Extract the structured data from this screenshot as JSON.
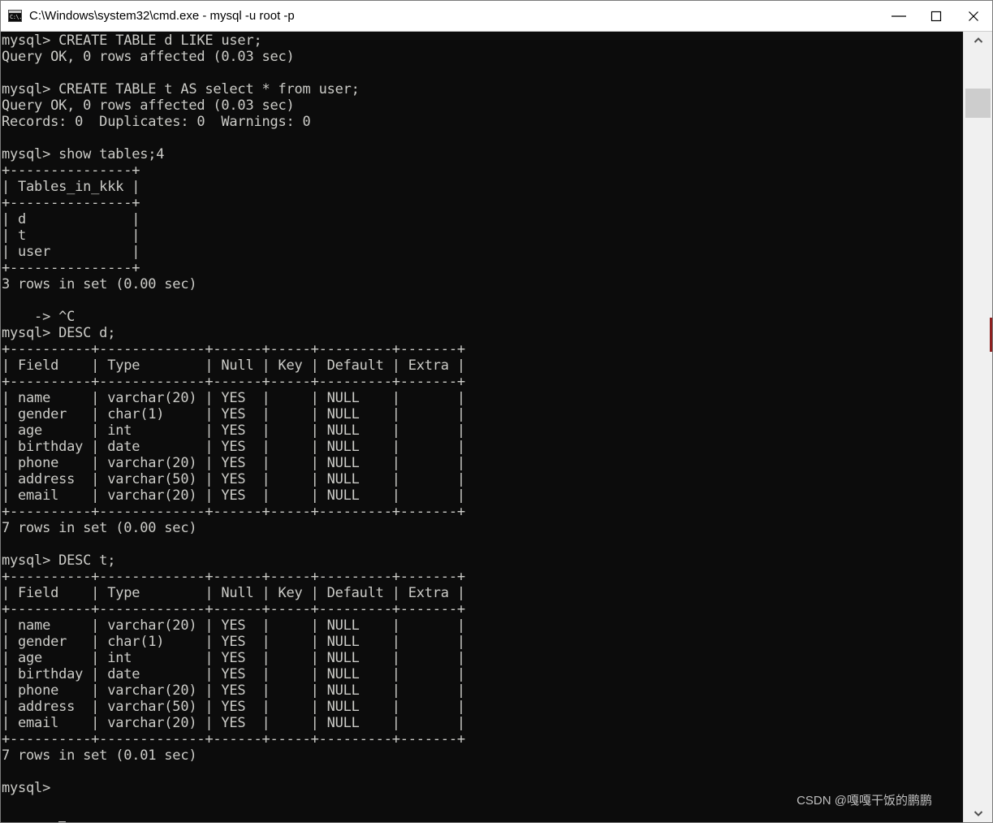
{
  "window": {
    "title": "C:\\Windows\\system32\\cmd.exe - mysql  -u root -p",
    "icon_name": "cmd-console-icon",
    "icon_text": "C:\\.",
    "bg_color": "#0c0c0c",
    "fg_color": "#ccccc8",
    "titlebar_bg": "#ffffff"
  },
  "controls": {
    "minimize_label": "Minimize",
    "maximize_label": "Maximize",
    "close_label": "Close"
  },
  "scrollbar": {
    "up_label": "Scroll up",
    "down_label": "Scroll down",
    "thumb_label": "Scroll thumb",
    "track_color": "#f0f0f0",
    "thumb_color": "#cdcdcd"
  },
  "watermark": {
    "text": "CSDN @嘎嘎干饭的鹏鹏"
  },
  "terminal": {
    "prompt": "mysql>",
    "cursor_visible": true,
    "commands": [
      "CREATE TABLE d LIKE user;",
      "CREATE TABLE t AS select * from user;",
      "show tables;4",
      "DESC d;",
      "DESC t;"
    ],
    "messages": [
      "Query OK, 0 rows affected (0.03 sec)",
      "Query OK, 0 rows affected (0.03 sec)",
      "Records: 0  Duplicates: 0  Warnings: 0",
      "3 rows in set (0.00 sec)",
      "7 rows in set (0.00 sec)",
      "7 rows in set (0.01 sec)"
    ],
    "continuation_line": "    -> ^C",
    "tables_result": {
      "header": "Tables_in_kkk",
      "rows": [
        "d",
        "t",
        "user"
      ],
      "row_count_text": "3 rows in set (0.00 sec)"
    },
    "desc_columns": [
      "Field",
      "Type",
      "Null",
      "Key",
      "Default",
      "Extra"
    ],
    "desc_rows": [
      {
        "Field": "name",
        "Type": "varchar(20)",
        "Null": "YES",
        "Key": "",
        "Default": "NULL",
        "Extra": ""
      },
      {
        "Field": "gender",
        "Type": "char(1)",
        "Null": "YES",
        "Key": "",
        "Default": "NULL",
        "Extra": ""
      },
      {
        "Field": "age",
        "Type": "int",
        "Null": "YES",
        "Key": "",
        "Default": "NULL",
        "Extra": ""
      },
      {
        "Field": "birthday",
        "Type": "date",
        "Null": "YES",
        "Key": "",
        "Default": "NULL",
        "Extra": ""
      },
      {
        "Field": "phone",
        "Type": "varchar(20)",
        "Null": "YES",
        "Key": "",
        "Default": "NULL",
        "Extra": ""
      },
      {
        "Field": "address",
        "Type": "varchar(50)",
        "Null": "YES",
        "Key": "",
        "Default": "NULL",
        "Extra": ""
      },
      {
        "Field": "email",
        "Type": "varchar(20)",
        "Null": "YES",
        "Key": "",
        "Default": "NULL",
        "Extra": ""
      }
    ],
    "screen_text": "mysql> CREATE TABLE d LIKE user;\nQuery OK, 0 rows affected (0.03 sec)\n\nmysql> CREATE TABLE t AS select * from user;\nQuery OK, 0 rows affected (0.03 sec)\nRecords: 0  Duplicates: 0  Warnings: 0\n\nmysql> show tables;4\n+---------------+\n| Tables_in_kkk |\n+---------------+\n| d             |\n| t             |\n| user          |\n+---------------+\n3 rows in set (0.00 sec)\n\n    -> ^C\nmysql> DESC d;\n+----------+-------------+------+-----+---------+-------+\n| Field    | Type        | Null | Key | Default | Extra |\n+----------+-------------+------+-----+---------+-------+\n| name     | varchar(20) | YES  |     | NULL    |       |\n| gender   | char(1)     | YES  |     | NULL    |       |\n| age      | int         | YES  |     | NULL    |       |\n| birthday | date        | YES  |     | NULL    |       |\n| phone    | varchar(20) | YES  |     | NULL    |       |\n| address  | varchar(50) | YES  |     | NULL    |       |\n| email    | varchar(20) | YES  |     | NULL    |       |\n+----------+-------------+------+-----+---------+-------+\n7 rows in set (0.00 sec)\n\nmysql> DESC t;\n+----------+-------------+------+-----+---------+-------+\n| Field    | Type        | Null | Key | Default | Extra |\n+----------+-------------+------+-----+---------+-------+\n| name     | varchar(20) | YES  |     | NULL    |       |\n| gender   | char(1)     | YES  |     | NULL    |       |\n| age      | int         | YES  |     | NULL    |       |\n| birthday | date        | YES  |     | NULL    |       |\n| phone    | varchar(20) | YES  |     | NULL    |       |\n| address  | varchar(50) | YES  |     | NULL    |       |\n| email    | varchar(20) | YES  |     | NULL    |       |\n+----------+-------------+------+-----+---------+-------+\n7 rows in set (0.01 sec)\n\nmysql> "
  }
}
